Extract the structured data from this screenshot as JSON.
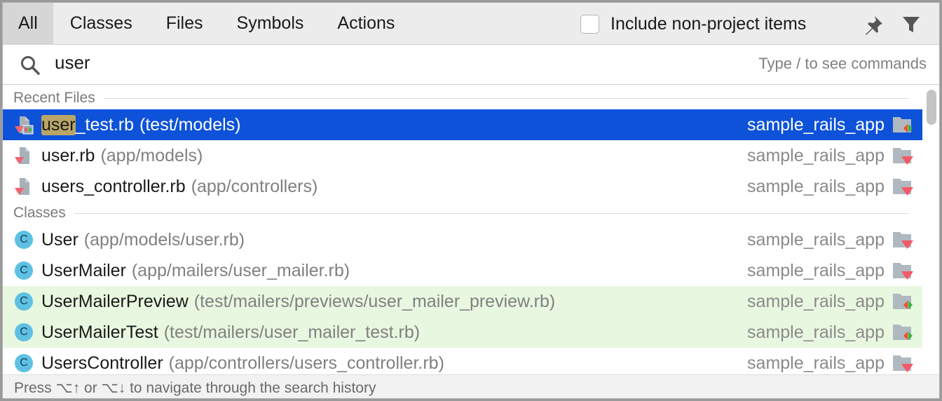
{
  "tabs": [
    "All",
    "Classes",
    "Files",
    "Symbols",
    "Actions"
  ],
  "selected_tab": "All",
  "include_label": "Include non-project items",
  "include_checked": false,
  "search": {
    "value": "user",
    "hint": "Type / to see commands"
  },
  "sections": [
    {
      "title": "Recent Files",
      "items": [
        {
          "name_hl": "user",
          "name": "_test.rb",
          "path": "(test/models)",
          "project": "sample_rails_app",
          "icon": "ruby-test-file-icon",
          "selected": true,
          "test": false
        },
        {
          "name_hl": "",
          "name": "user.rb",
          "path": "(app/models)",
          "project": "sample_rails_app",
          "icon": "ruby-file-icon",
          "selected": false,
          "test": false
        },
        {
          "name_hl": "",
          "name": "users_controller.rb",
          "path": "(app/controllers)",
          "project": "sample_rails_app",
          "icon": "ruby-file-icon",
          "selected": false,
          "test": false
        }
      ]
    },
    {
      "title": "Classes",
      "items": [
        {
          "name_hl": "",
          "name": "User",
          "path": "(app/models/user.rb)",
          "project": "sample_rails_app",
          "icon": "class-icon",
          "selected": false,
          "test": false
        },
        {
          "name_hl": "",
          "name": "UserMailer",
          "path": "(app/mailers/user_mailer.rb)",
          "project": "sample_rails_app",
          "icon": "class-icon",
          "selected": false,
          "test": false
        },
        {
          "name_hl": "",
          "name": "UserMailerPreview",
          "path": "(test/mailers/previews/user_mailer_preview.rb)",
          "project": "sample_rails_app",
          "icon": "class-icon",
          "selected": false,
          "test": true
        },
        {
          "name_hl": "",
          "name": "UserMailerTest",
          "path": "(test/mailers/user_mailer_test.rb)",
          "project": "sample_rails_app",
          "icon": "class-icon",
          "selected": false,
          "test": true
        },
        {
          "name_hl": "",
          "name": "UsersController",
          "path": "(app/controllers/users_controller.rb)",
          "project": "sample_rails_app",
          "icon": "class-icon",
          "selected": false,
          "test": false
        }
      ]
    }
  ],
  "class_letter": "C",
  "footer": "Press ⌥↑ or ⌥↓ to navigate through the search history",
  "colors": {
    "selection": "#0d52d9",
    "test_row": "#e8f8e0",
    "match_highlight": "#b9a667",
    "class_icon": "#5ec1e3"
  }
}
